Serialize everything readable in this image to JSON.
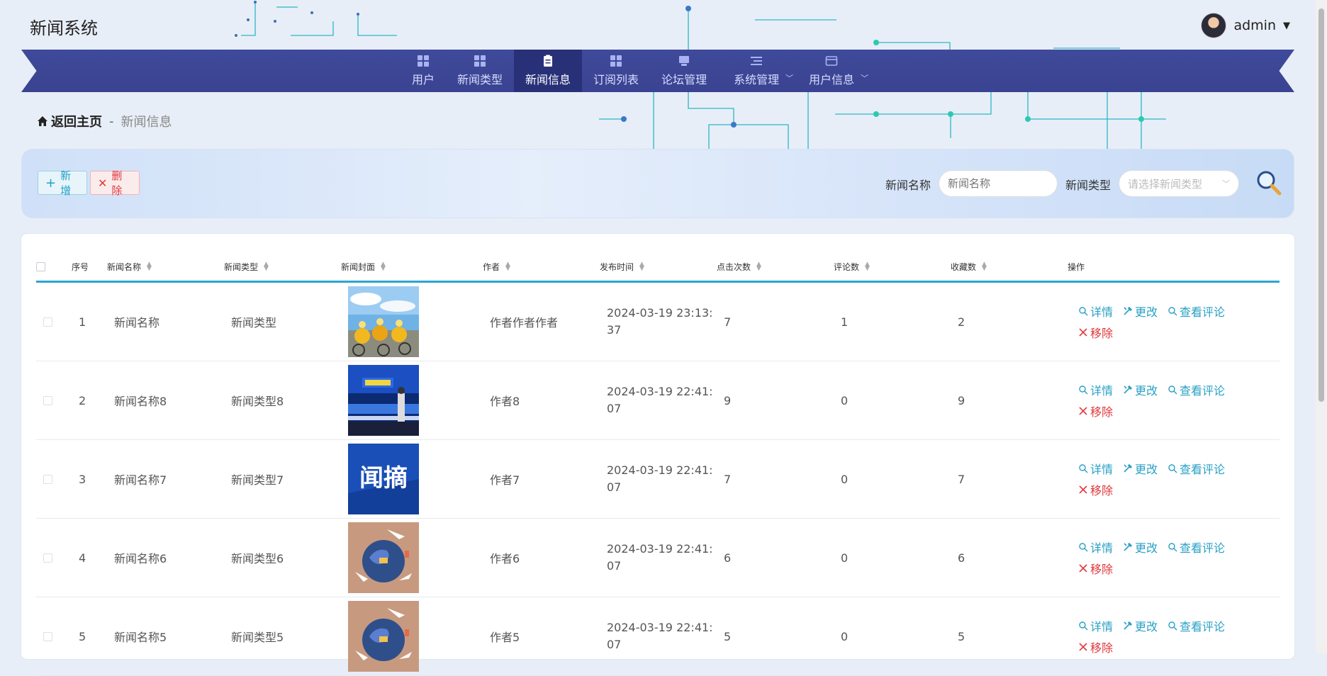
{
  "app": {
    "title": "新闻系统"
  },
  "user": {
    "name": "admin"
  },
  "nav": {
    "items": [
      {
        "label": "用户",
        "icon": "grid-icon"
      },
      {
        "label": "新闻类型",
        "icon": "grid-icon"
      },
      {
        "label": "新闻信息",
        "icon": "clipboard-icon",
        "active": true
      },
      {
        "label": "订阅列表",
        "icon": "grid-icon"
      },
      {
        "label": "论坛管理",
        "icon": "monitor-icon"
      },
      {
        "label": "系统管理",
        "icon": "list-icon",
        "dropdown": true
      },
      {
        "label": "用户信息",
        "icon": "card-icon",
        "dropdown": true
      }
    ]
  },
  "breadcrumb": {
    "home": "返回主页",
    "separator": "-",
    "current": "新闻信息"
  },
  "toolbar": {
    "add_label": "新增",
    "delete_label": "删除"
  },
  "search": {
    "name_label": "新闻名称",
    "name_placeholder": "新闻名称",
    "type_label": "新闻类型",
    "type_placeholder": "请选择新闻类型"
  },
  "table": {
    "headers": [
      "序号",
      "新闻名称",
      "新闻类型",
      "新闻封面",
      "作者",
      "发布时间",
      "点击次数",
      "评论数",
      "收藏数",
      "操作"
    ],
    "actions": {
      "detail": "详情",
      "edit": "更改",
      "comments": "查看评论",
      "remove": "移除"
    },
    "rows": [
      {
        "no": "1",
        "name": "新闻名称",
        "type": "新闻类型",
        "cover": "cycling-photo",
        "author": "作者作者作者",
        "time_a": "2024-03-19 23:13:",
        "time_b": "37",
        "clicks": "7",
        "comments": "1",
        "favorites": "2"
      },
      {
        "no": "2",
        "name": "新闻名称8",
        "type": "新闻类型8",
        "cover": "stage-photo",
        "author": "作者8",
        "time_a": "2024-03-19 22:41:",
        "time_b": "07",
        "clicks": "9",
        "comments": "0",
        "favorites": "9"
      },
      {
        "no": "3",
        "name": "新闻名称7",
        "type": "新闻类型7",
        "cover": "news-digest-graphic",
        "cover_text": "闻摘",
        "author": "作者7",
        "time_a": "2024-03-19 22:41:",
        "time_b": "07",
        "clicks": "7",
        "comments": "0",
        "favorites": "7"
      },
      {
        "no": "4",
        "name": "新闻名称6",
        "type": "新闻类型6",
        "cover": "globe-travel-illustration",
        "author": "作者6",
        "time_a": "2024-03-19 22:41:",
        "time_b": "07",
        "clicks": "6",
        "comments": "0",
        "favorites": "6"
      },
      {
        "no": "5",
        "name": "新闻名称5",
        "type": "新闻类型5",
        "cover": "globe-travel-illustration",
        "author": "作者5",
        "time_a": "2024-03-19 22:41:",
        "time_b": "07",
        "clicks": "5",
        "comments": "0",
        "favorites": "5"
      }
    ]
  },
  "colors": {
    "nav": "#3a4391",
    "nav_active": "#283178",
    "accent": "#2aa6d2",
    "danger": "#e0383b"
  }
}
